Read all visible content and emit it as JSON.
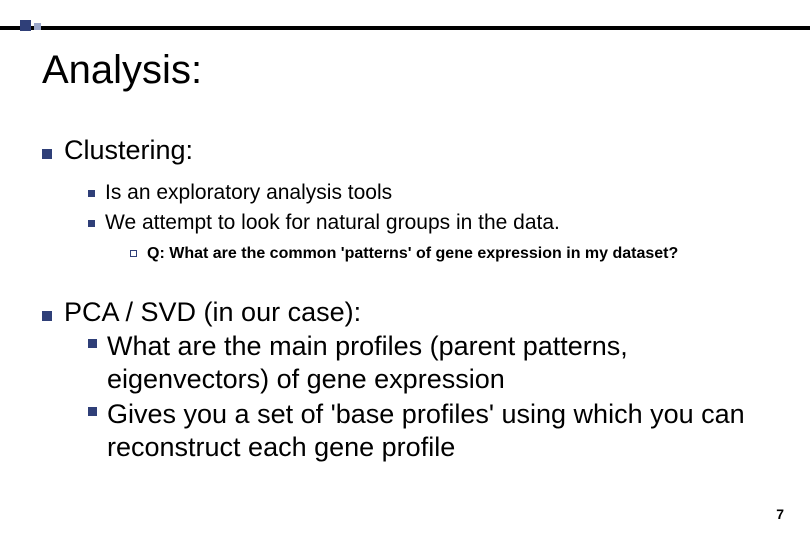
{
  "title": "Analysis:",
  "sections": [
    {
      "heading": "Clustering:",
      "items": [
        "Is an exploratory analysis tools",
        "We attempt to look for natural groups in the data."
      ],
      "subitem": "Q: What are the common 'patterns' of gene expression in my dataset?"
    },
    {
      "heading": "PCA / SVD (in our case):",
      "items": [
        "What are the main profiles (parent patterns, eigenvectors) of gene expression",
        "Gives you a set of 'base profiles' using which you can reconstruct each gene profile"
      ]
    }
  ],
  "page_number": "7"
}
